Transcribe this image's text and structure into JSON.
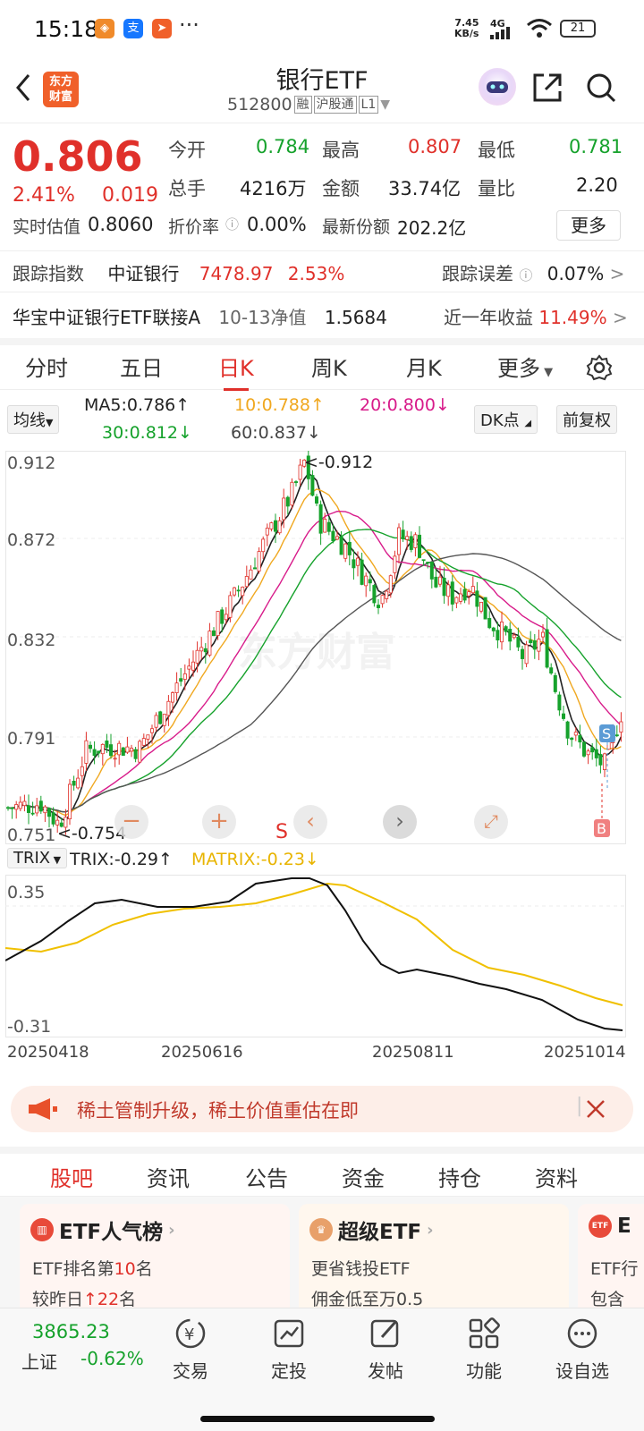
{
  "status": {
    "time": "15:18",
    "speed_top": "7.45",
    "speed_bottom": "KB/s",
    "network": "4G",
    "battery": "21",
    "more": "···"
  },
  "header": {
    "logo_line1": "东方",
    "logo_line2": "财富",
    "title": "银行ETF",
    "code": "512800",
    "tag1": "融",
    "tag2": "沪股通",
    "tag3": "L1"
  },
  "quote": {
    "price": "0.806",
    "change_pct": "2.41%",
    "change_abs": "0.019",
    "open_label": "今开",
    "open": "0.784",
    "high_label": "最高",
    "high": "0.807",
    "low_label": "最低",
    "low": "0.781",
    "volume_label": "总手",
    "volume": "4216万",
    "amount_label": "金额",
    "amount": "33.74亿",
    "ratio_label": "量比",
    "ratio": "2.20",
    "iopv_label": "实时估值",
    "iopv": "0.8060",
    "premium_label": "折价率",
    "premium": "0.00%",
    "shares_label": "最新份额",
    "shares": "202.2亿",
    "more_button": "更多"
  },
  "tracking": {
    "label": "跟踪指数",
    "index_name": "中证银行",
    "index_value": "7478.97",
    "index_change": "2.53%",
    "error_label": "跟踪误差",
    "error_value": "0.07%"
  },
  "fund": {
    "name": "华宝中证银行ETF联接A",
    "nav_label": "10-13净值",
    "nav_value": "1.5684",
    "return_label": "近一年收益",
    "return_value": "11.49%"
  },
  "chart_tabs": [
    "分时",
    "五日",
    "日K",
    "周K",
    "月K",
    "更多"
  ],
  "chart_tab_active": "日K",
  "ma": {
    "selector": "均线",
    "ma5": "MA5:0.786↑",
    "ma10": "10:0.788↑",
    "ma20": "20:0.800↓",
    "ma30": "30:0.812↓",
    "ma60": "60:0.837↓",
    "dk_button": "DK点",
    "adjust_button": "前复权",
    "colors": {
      "ma5": "#222222",
      "ma10": "#f0a820",
      "ma20": "#d81b8a",
      "ma30": "#16a22c",
      "ma60": "#555555"
    }
  },
  "kchart": {
    "y_labels": [
      "0.912",
      "0.872",
      "0.832",
      "0.791",
      "0.751"
    ],
    "max_marker": "<-0.912",
    "min_marker": "<-0.754",
    "watermark": "东方财富",
    "sell_mark": "S",
    "buy_mark": "B",
    "s_mark": "S"
  },
  "trix": {
    "selector": "TRIX",
    "trix": "TRIX:-0.29↑",
    "matrix": "MATRIX:-0.23↓",
    "y_top": "0.35",
    "y_bottom": "-0.31"
  },
  "chart_data": {
    "type": "candlestick",
    "y_range": [
      0.751,
      0.912
    ],
    "x_ticks": [
      "20250418",
      "20250616",
      "20250811",
      "20251014"
    ],
    "series": [
      {
        "name": "MA5",
        "value": 0.786
      },
      {
        "name": "10",
        "value": 0.788
      },
      {
        "name": "20",
        "value": 0.8
      },
      {
        "name": "30",
        "value": 0.812
      },
      {
        "name": "60",
        "value": 0.837
      }
    ],
    "max": 0.912,
    "min": 0.754,
    "indicator": {
      "name": "TRIX",
      "trix": -0.29,
      "matrix": -0.23,
      "y_range": [
        -0.31,
        0.35
      ]
    }
  },
  "banner": {
    "text": "稀土管制升级，稀土价值重估在即"
  },
  "content_tabs": [
    "股吧",
    "资讯",
    "公告",
    "资金",
    "持仓",
    "资料"
  ],
  "content_tab_active": "股吧",
  "cards": [
    {
      "title": "ETF人气榜",
      "line1_a": "ETF排名第",
      "line1_b": "10",
      "line1_c": "名",
      "line2_a": "较昨日",
      "line2_b": "↑22",
      "line2_c": "名",
      "icon": "ETF"
    },
    {
      "title": "超级ETF",
      "line1": "更省钱投ETF",
      "line2": "佣金低至万0.5",
      "icon": "ETF"
    },
    {
      "title": "E",
      "line1": "ETF行",
      "line2": "包含",
      "icon": "ETF"
    }
  ],
  "bottom": {
    "index_value": "3865.23",
    "index_name": "上证",
    "index_change": "-0.62%",
    "items": [
      "交易",
      "定投",
      "发帖",
      "功能",
      "设自选"
    ]
  }
}
